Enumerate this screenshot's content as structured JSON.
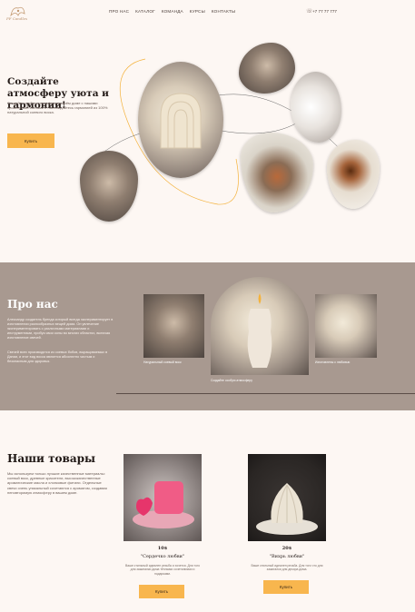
{
  "header": {
    "logo_text": "PF Candles",
    "nav": [
      "ПРО НАС",
      "КАТАЛОГ",
      "КОМАНДА",
      "КУРСЫ",
      "КОНТАКТЫ"
    ],
    "phone": "+7 77 77 777"
  },
  "hero": {
    "title": "Создайте атмосферу уюта и гармонии!",
    "text": "Создайте особую атмосферу в своём доме с нашими ароматными свечами и наслаждайтесь гармонией из 100% натуральной соевого воска.",
    "button": "Купить"
  },
  "about": {
    "title": "Про нас",
    "text1": "Александр создатель бренда который всегда экспериментирует в изготовлении разнообразных вещей дома. Он увлечение экспериментировать с различными материалами и инструментами, пробуя свои силы во многих областях, включая изготовление свечей.",
    "text2": "Свечей всех производятся из соевых бобов, выращиваемых в Дании, и этот вид воска является абсолютно чистым и безопасным для здоровья.",
    "caption1": "Натуральный соевый воск",
    "caption2": "Создайте особую атмосферу",
    "caption3": "Изготовлены с любовью"
  },
  "products": {
    "title": "Наши товары",
    "text": "Мы используем только лучшие качественные материалы: соевый воск, древные красители, высококачественные ароматические масла и хлопковые фитили. Отдельные свечи очень уникальный сочетаются с ароматом, создавая неповторимую атмосферу в вашем доме.",
    "items": [
      {
        "price": "10$",
        "name": "\"Сердечко любви\"",
        "desc": "Ваше стильный идеален резьба и хочется. Для того для зажигалки дома тёплыми сочетаниями и подарками.",
        "button": "Купить"
      },
      {
        "price": "20$",
        "name": "\"Вихрь любви\"",
        "desc": "Ваше стильный идеален резьба. Для того что для зажигалки для декора дома.",
        "button": "Купить"
      }
    ]
  }
}
